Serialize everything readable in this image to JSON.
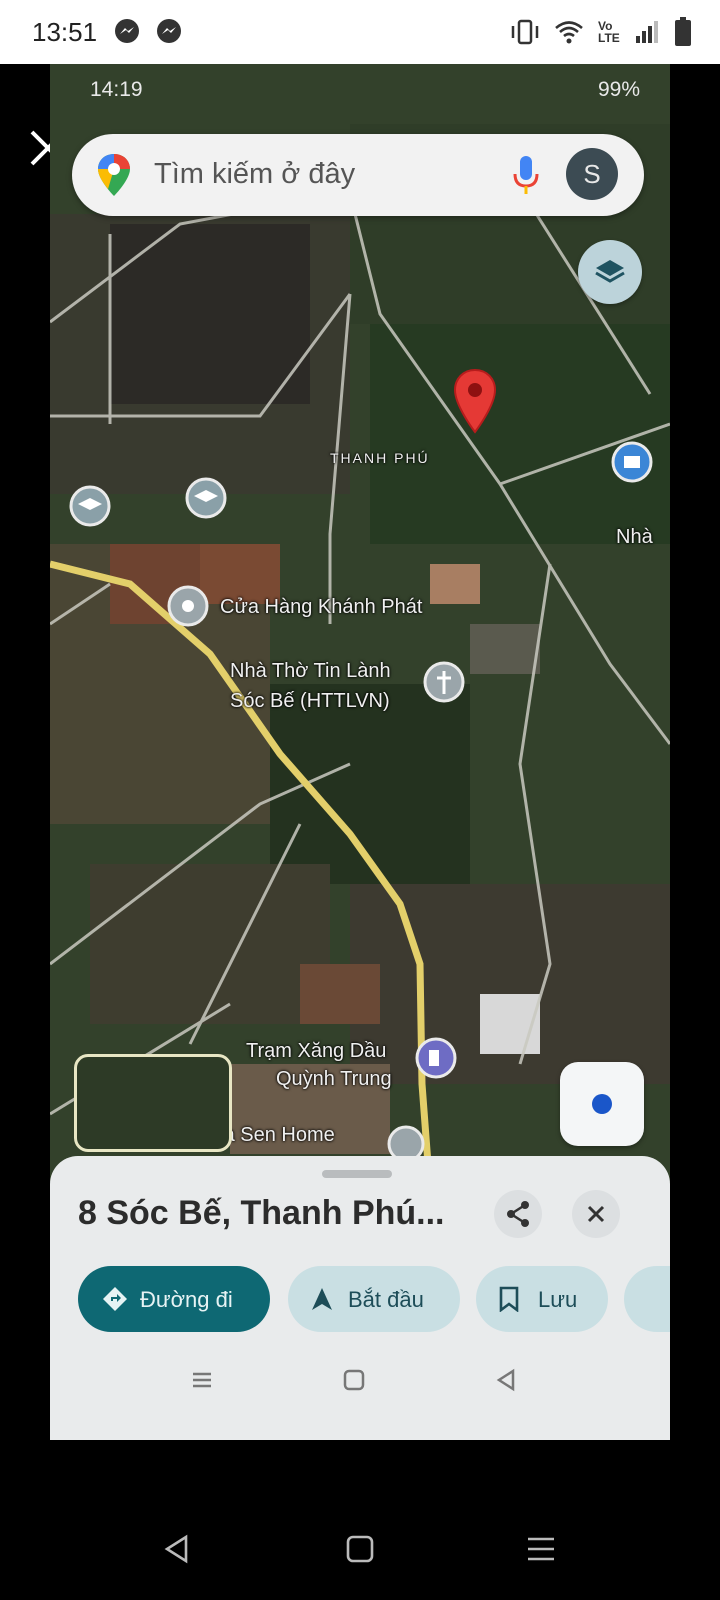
{
  "status_bar": {
    "time": "13:51",
    "icons": [
      "messenger-icon",
      "messenger-icon",
      "vibrate-icon",
      "wifi-icon",
      "volte-icon",
      "signal-icon",
      "battery-icon"
    ],
    "volte_label": "Vo LTE"
  },
  "viewer": {
    "close_icon": "close-icon",
    "accent": "#ffffff"
  },
  "inner_status": {
    "time": "14:19",
    "battery": "99%"
  },
  "search": {
    "placeholder": "Tìm kiếm ở đây",
    "avatar_letter": "S"
  },
  "map": {
    "pin_label": "THANH PHÚ",
    "places": [
      "Cửa Hàng Khánh Phát",
      "Nhà Thờ Tin Lành",
      "Sóc Bế (HTTLVN)",
      "Trạm Xăng Dầu",
      "Quỳnh Trung",
      "Hoa Sen Home",
      "Nhà"
    ],
    "pin_color": "#e53935",
    "road_color": "#e3cf6a"
  },
  "sheet": {
    "title": "8 Sóc Bế, Thanh Phú...",
    "chips": [
      {
        "label": "Đường đi",
        "icon": "directions-icon"
      },
      {
        "label": "Bắt đầu",
        "icon": "navigation-arrow-icon"
      },
      {
        "label": "Lưu",
        "icon": "bookmark-icon"
      }
    ],
    "accent": "#0e6873"
  }
}
